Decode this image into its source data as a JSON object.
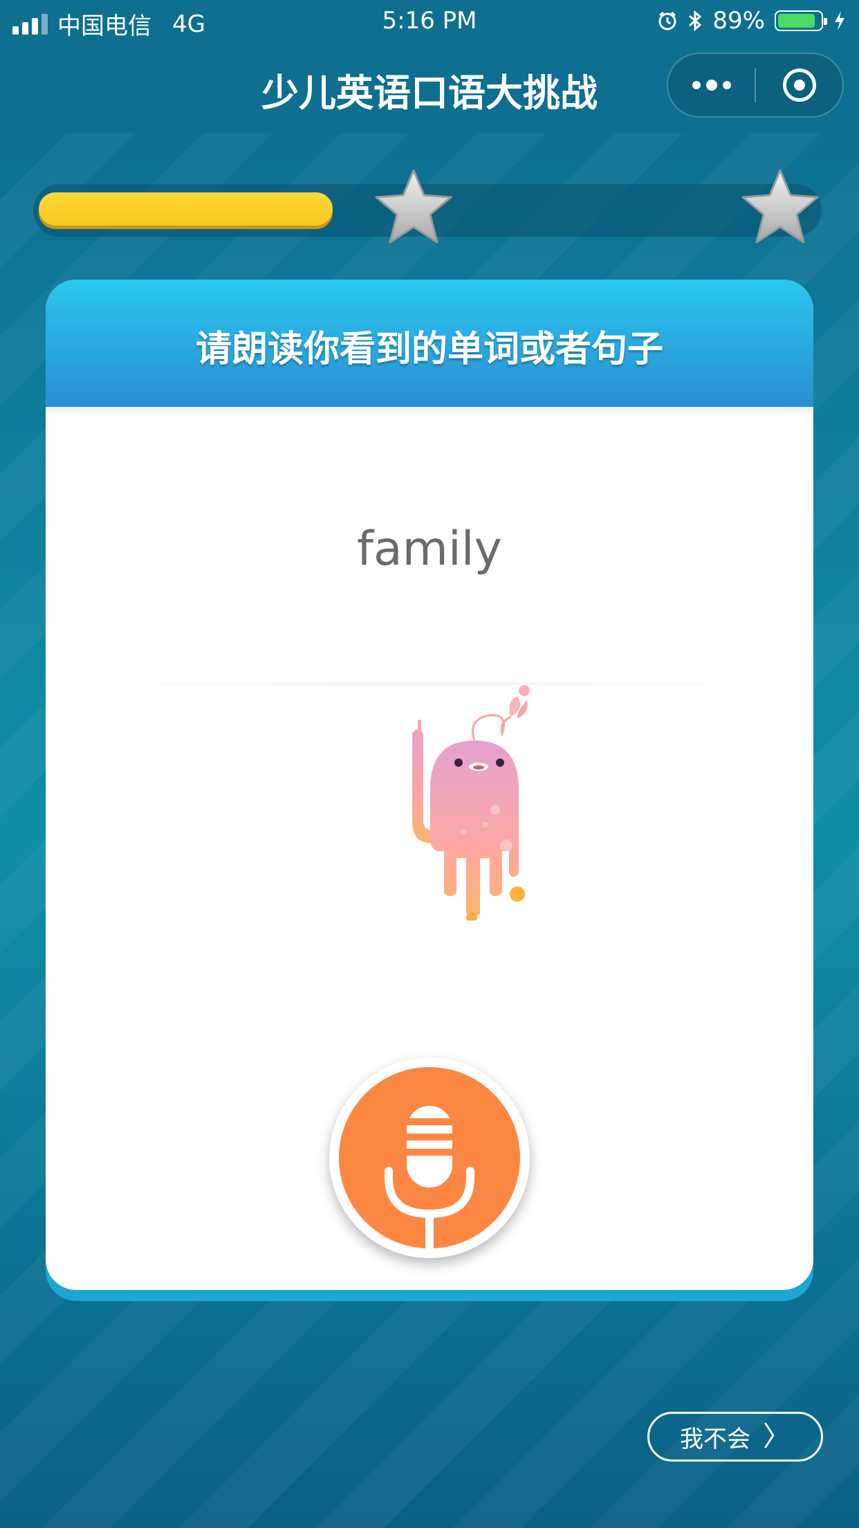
{
  "status_bar": {
    "carrier": "中国电信",
    "network": "4G",
    "time": "5:16 PM",
    "battery": "89%",
    "battery_level": 0.89,
    "icons": [
      "signal-icon",
      "alarm-icon",
      "bluetooth-icon",
      "battery-icon",
      "charging-icon"
    ]
  },
  "nav": {
    "title": "少儿英语口语大挑战",
    "menu_icon": "more-dots-icon",
    "close_icon": "target-icon"
  },
  "progress": {
    "value": 0.27,
    "stars": 2,
    "star_color": "#c8c8c8",
    "fill_color": "#ffd42a"
  },
  "card": {
    "title": "请朗读你看到的单词或者句子",
    "word": "family",
    "mic_color": "#fc8742",
    "mic_icon": "microphone-icon",
    "mascot": "octopus-mascot"
  },
  "dont_know_button": {
    "label": "我不会",
    "icon": "chevron-right-icon"
  }
}
